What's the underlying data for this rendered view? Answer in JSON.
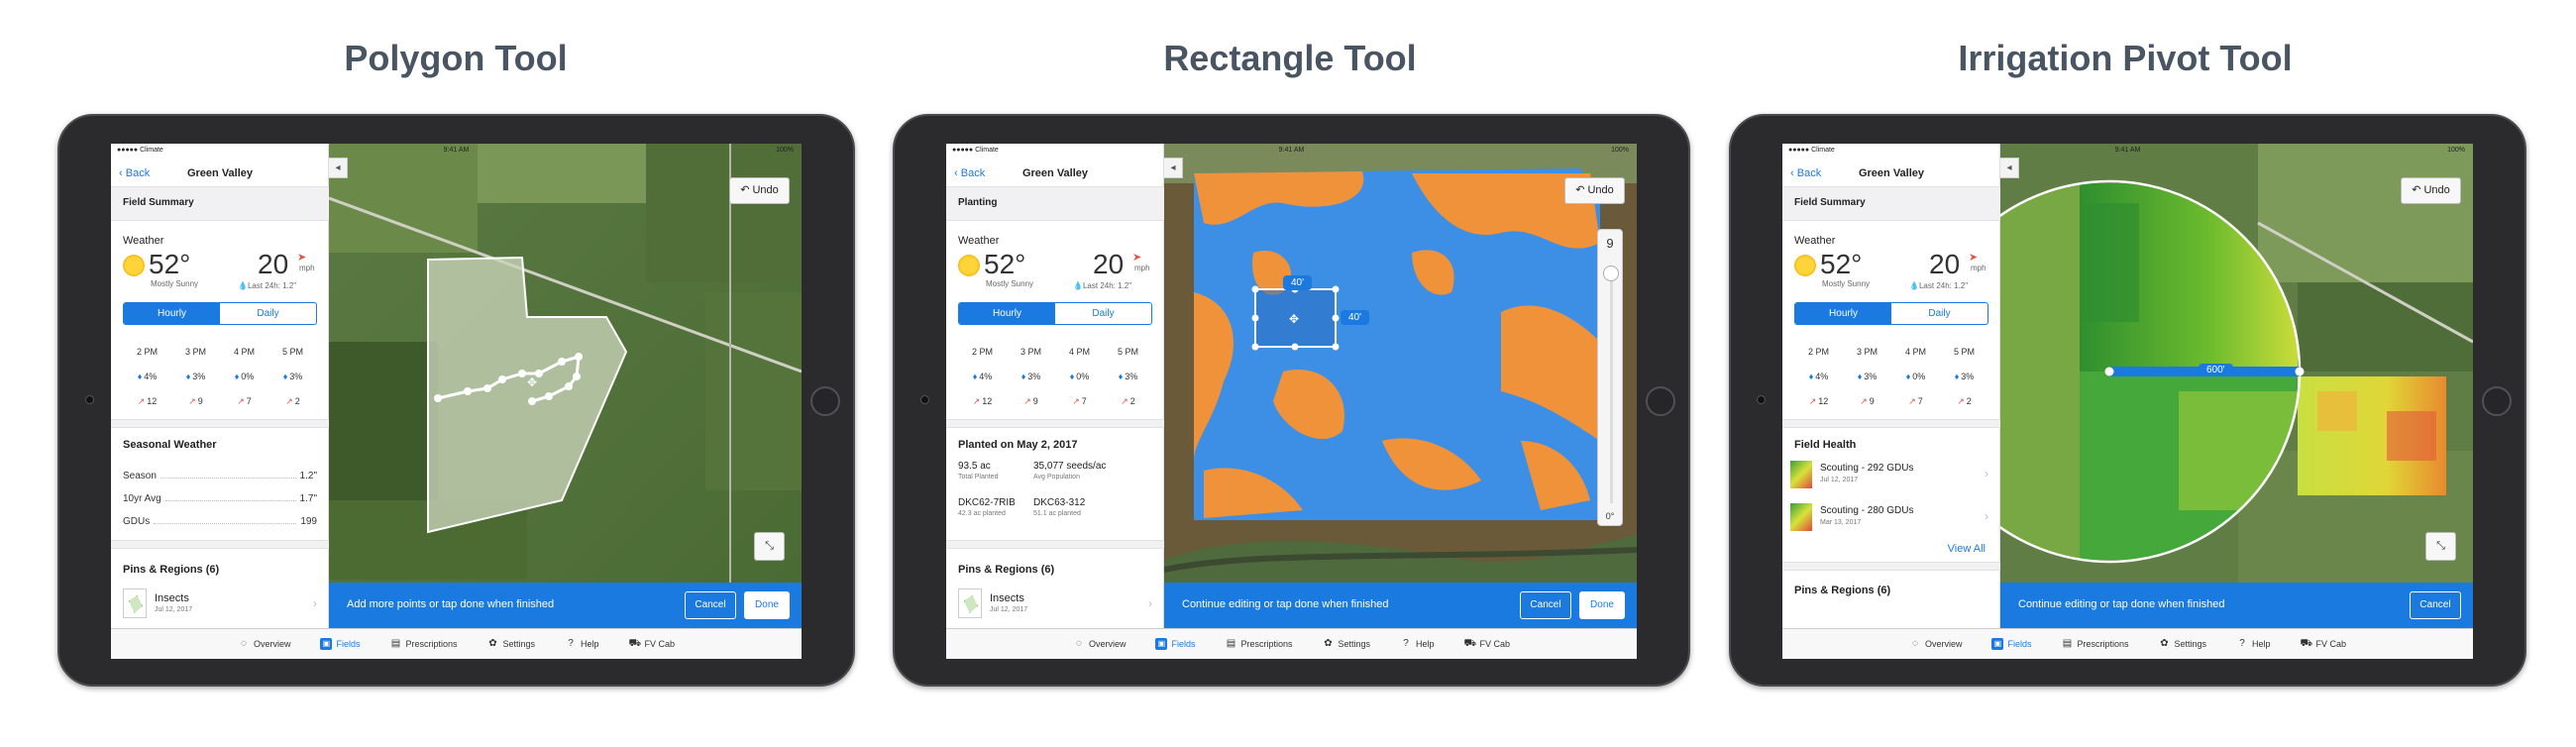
{
  "titles": [
    "Polygon Tool",
    "Rectangle Tool",
    "Irrigation Pivot Tool"
  ],
  "status": {
    "carrier": "●●●●● Climate",
    "time": "9:41 AM",
    "battery": "100%"
  },
  "nav": {
    "back": "Back",
    "title": "Green Valley"
  },
  "weather": {
    "label": "Weather",
    "temp": "52°",
    "condition": "Mostly Sunny",
    "wind": "20",
    "wind_unit": "mph",
    "rain": "Last 24h: 1.2\"",
    "tabs": [
      "Hourly",
      "Daily"
    ],
    "hours": [
      "2 PM",
      "3 PM",
      "4 PM",
      "5 PM"
    ],
    "precip": [
      "4%",
      "3%",
      "0%",
      "3%"
    ],
    "winds": [
      "12",
      "9",
      "7",
      "2"
    ]
  },
  "seasonal": {
    "title": "Seasonal Weather",
    "rows": [
      {
        "k": "Season",
        "v": "1.2\""
      },
      {
        "k": "10yr Avg",
        "v": "1.7\""
      },
      {
        "k": "GDUs",
        "v": "199"
      }
    ]
  },
  "pins": {
    "title": "Pins & Regions (6)",
    "item": "Insects",
    "date": "Jul 12, 2017"
  },
  "tabs": [
    {
      "icon": "◌",
      "label": "Overview"
    },
    {
      "icon": "▣",
      "label": "Fields"
    },
    {
      "icon": "▤",
      "label": "Prescriptions"
    },
    {
      "icon": "✿",
      "label": "Settings"
    },
    {
      "icon": "?",
      "label": "Help"
    },
    {
      "icon": "⛟",
      "label": "FV Cab"
    }
  ],
  "map": {
    "undo": "Undo",
    "expand": "⤡",
    "collapse": "◂",
    "cancel": "Cancel",
    "done": "Done"
  },
  "panel1": {
    "section": "Field Summary",
    "msg": "Add more points or tap done when finished"
  },
  "panel2": {
    "section": "Planting",
    "planted_title": "Planted on May 2, 2017",
    "stats": [
      {
        "v": "93.5 ac",
        "l": "Total Planted"
      },
      {
        "v": "35,077 seeds/ac",
        "l": "Avg Population"
      },
      {
        "v": "DKC62-7RIB",
        "l": "42.3 ac planted"
      },
      {
        "v": "DKC63-312",
        "l": "51.1 ac planted"
      }
    ],
    "msg": "Continue editing or tap done when finished",
    "dim1": "40'",
    "dim2": "40'",
    "slider_top": "9",
    "slider_bottom": "0°"
  },
  "panel3": {
    "section": "Field Summary",
    "health_title": "Field Health",
    "health": [
      {
        "name": "Scouting - 292 GDUs",
        "date": "Jul 12, 2017"
      },
      {
        "name": "Scouting - 280 GDUs",
        "date": "Mar 13, 2017"
      }
    ],
    "view_all": "View All",
    "pins_title": "Pins & Regions (6)",
    "msg": "Continue editing or tap done when finished",
    "radius": "600'"
  }
}
